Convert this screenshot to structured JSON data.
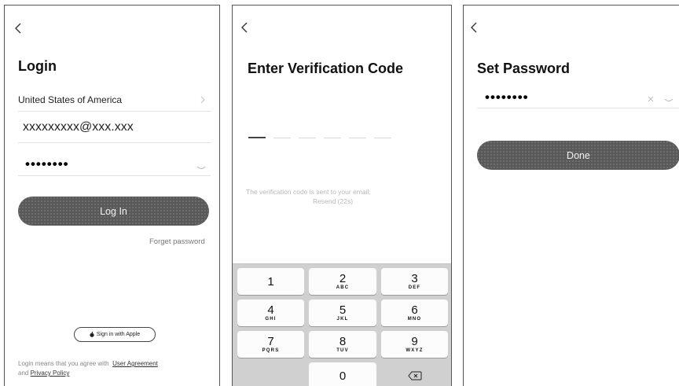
{
  "login": {
    "title": "Login",
    "country": "United States of America",
    "email_value": "xxxxxxxxx@xxx.xxx",
    "password_mask": "••••••••",
    "login_button": "Log In",
    "forgot_link": "Forget password",
    "apple_button": "Sign in with Apple",
    "legal_prefix": "Login means that you agree with",
    "user_agreement": "User Agreement",
    "legal_and": "and",
    "privacy_policy": "Privacy Policy"
  },
  "verify": {
    "title": "Enter Verification Code",
    "hint_line": "The verification code is sent to your email:",
    "resend": "Resend (22s)",
    "keys": [
      {
        "num": "1",
        "letters": ""
      },
      {
        "num": "2",
        "letters": "ABC"
      },
      {
        "num": "3",
        "letters": "DEF"
      },
      {
        "num": "4",
        "letters": "GHI"
      },
      {
        "num": "5",
        "letters": "JKL"
      },
      {
        "num": "6",
        "letters": "MNO"
      },
      {
        "num": "7",
        "letters": "PQRS"
      },
      {
        "num": "8",
        "letters": "TUV"
      },
      {
        "num": "9",
        "letters": "WXYZ"
      },
      {
        "num": "0",
        "letters": ""
      }
    ]
  },
  "set_password": {
    "title": "Set Password",
    "password_mask": "••••••••",
    "done_button": "Done"
  },
  "icons": {
    "back": "chevron-left-icon",
    "chevron_right": "chevron-right-icon",
    "eye": "eye-closed-icon",
    "clear": "close-icon",
    "apple": "apple-logo-icon",
    "backspace": "backspace-icon"
  }
}
